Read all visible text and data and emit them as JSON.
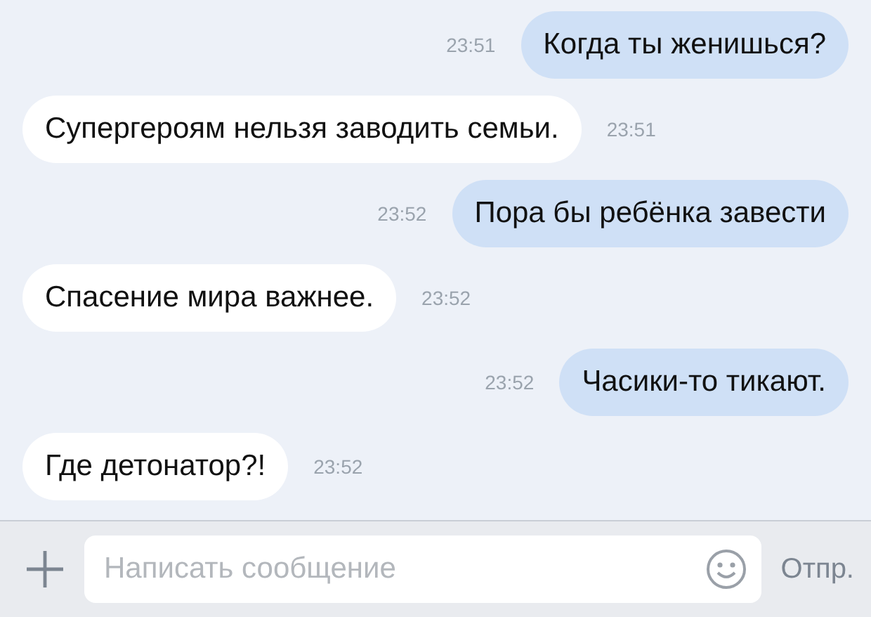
{
  "messages": [
    {
      "kind": "outgoing",
      "text": "Когда ты женишься?",
      "time": "23:51"
    },
    {
      "kind": "incoming",
      "text": "Супергероям нельзя заводить семьи.",
      "time": "23:51"
    },
    {
      "kind": "outgoing",
      "text": "Пора бы ребёнка завести",
      "time": "23:52"
    },
    {
      "kind": "incoming",
      "text": "Спасение мира важнее.",
      "time": "23:52"
    },
    {
      "kind": "outgoing",
      "text": "Часики-то тикают.",
      "time": "23:52"
    },
    {
      "kind": "incoming",
      "text": "Где детонатор?!",
      "time": "23:52"
    }
  ],
  "composer": {
    "placeholder": "Написать сообщение",
    "send": "Отпр."
  }
}
